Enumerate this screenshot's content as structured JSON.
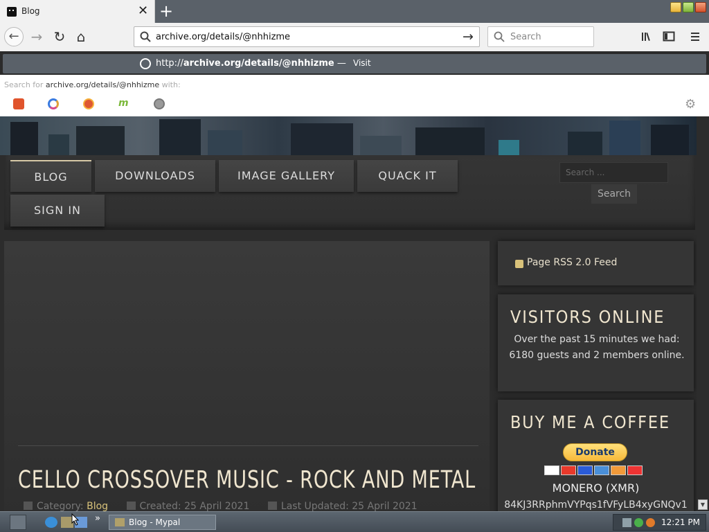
{
  "browser": {
    "tab_title": "Blog",
    "new_tab_symbol": "+",
    "url": "archive.org/details/@nhhizme",
    "search_placeholder": "Search",
    "popup": {
      "prefix": "http://",
      "domain": "archive.org/details/@nhhizme",
      "separator": "—",
      "action": "Visit"
    },
    "search_with": {
      "prefix": "Search for",
      "query": "archive.org/details/@nhhizme",
      "suffix": "with:"
    },
    "engines": [
      "brave-icon",
      "qwant-icon",
      "duckduckgo-icon",
      "mojeek-icon",
      "searx-icon"
    ]
  },
  "site": {
    "nav": {
      "blog": "BLOG",
      "downloads": "DOWNLOADS",
      "gallery": "IMAGE GALLERY",
      "quack": "QUACK IT",
      "signin": "SIGN IN"
    },
    "search_placeholder": "Search ...",
    "search_button": "Search",
    "article": {
      "title": "CELLO CROSSOVER MUSIC - ROCK AND METAL",
      "category_label": "Category:",
      "category": "Blog",
      "created": "Created: 25 April 2021",
      "updated": "Last Updated: 25 April 2021"
    },
    "rss": "Page RSS 2.0 Feed",
    "visitors": {
      "title": "VISITORS ONLINE",
      "text": "Over the past 15 minutes we had: 6180 guests and 2 members online."
    },
    "coffee": {
      "title": "BUY ME A COFFEE",
      "donate": "Donate",
      "currency": "MONERO (XMR)",
      "address": "84KJ3RRphmVYPqs1fVFyLB4xyGNQv1"
    }
  },
  "taskbar": {
    "task": "Blog - Mypal",
    "clock": "12:21 PM",
    "more": "»"
  },
  "colors": {
    "accent_gold": "#d8c27a",
    "title_cream": "#f0e6cf"
  }
}
